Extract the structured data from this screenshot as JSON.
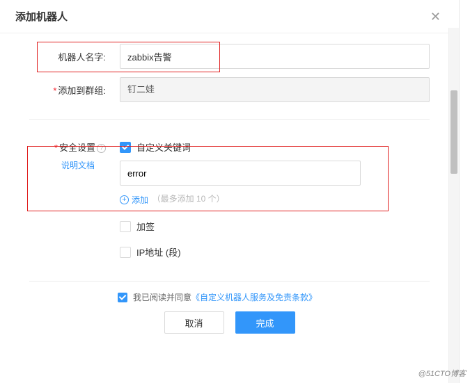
{
  "header": {
    "title": "添加机器人"
  },
  "form": {
    "name_label": "机器人名字:",
    "name_value": "zabbix告警",
    "group_label": "添加到群组:",
    "group_value": "钉二娃"
  },
  "security": {
    "label": "安全设置",
    "doc_link": "说明文档",
    "custom_keyword_label": "自定义关键词",
    "keyword_value": "error",
    "add_label": "添加",
    "add_hint": "（最多添加 10 个）",
    "sign_label": "加签",
    "ip_label": "IP地址 (段)"
  },
  "agree": {
    "prefix": "我已阅读并同意",
    "terms": "《自定义机器人服务及免责条款》"
  },
  "footer": {
    "cancel": "取消",
    "ok": "完成"
  },
  "watermark": "@51CTO博客"
}
